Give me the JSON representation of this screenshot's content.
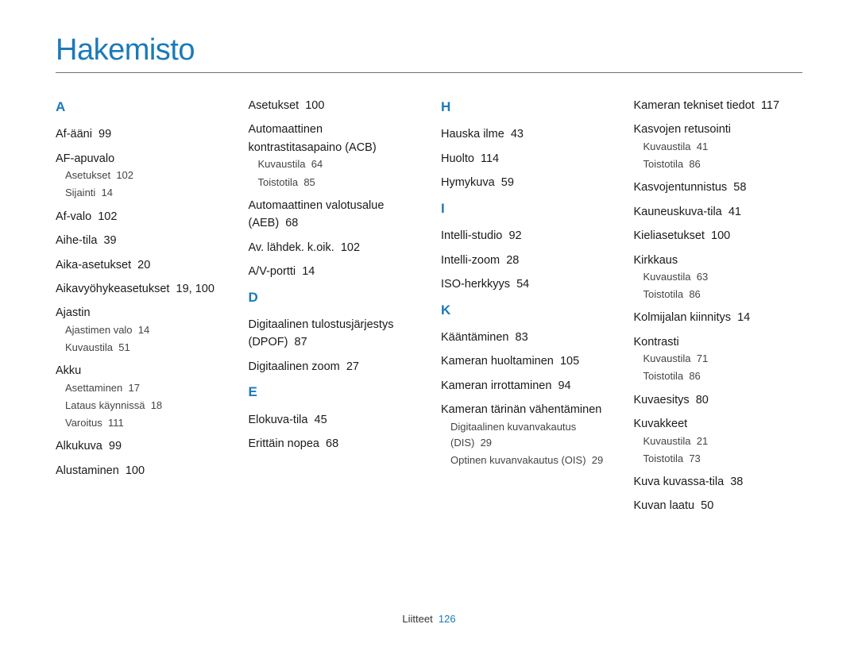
{
  "title": "Hakemisto",
  "footer": {
    "label": "Liitteet",
    "page": "126"
  },
  "columns": [
    [
      {
        "type": "letter",
        "text": "A"
      },
      {
        "type": "entry",
        "text": "Af-ääni",
        "pages": "99"
      },
      {
        "type": "entry",
        "text": "AF-apuvalo",
        "sub": [
          {
            "text": "Asetukset",
            "pages": "102"
          },
          {
            "text": "Sijainti",
            "pages": "14"
          }
        ]
      },
      {
        "type": "entry",
        "text": "Af-valo",
        "pages": "102"
      },
      {
        "type": "entry",
        "text": "Aihe-tila",
        "pages": "39"
      },
      {
        "type": "entry",
        "text": "Aika-asetukset",
        "pages": "20"
      },
      {
        "type": "entry",
        "text": "Aikavyöhykeasetukset",
        "pages": "19, 100"
      },
      {
        "type": "entry",
        "text": "Ajastin",
        "sub": [
          {
            "text": "Ajastimen valo",
            "pages": "14"
          },
          {
            "text": "Kuvaustila",
            "pages": "51"
          }
        ]
      },
      {
        "type": "entry",
        "text": "Akku",
        "sub": [
          {
            "text": "Asettaminen",
            "pages": "17"
          },
          {
            "text": "Lataus käynnissä",
            "pages": "18"
          },
          {
            "text": "Varoitus",
            "pages": "111"
          }
        ]
      },
      {
        "type": "entry",
        "text": "Alkukuva",
        "pages": "99"
      },
      {
        "type": "entry",
        "text": "Alustaminen",
        "pages": "100"
      }
    ],
    [
      {
        "type": "entry",
        "text": "Asetukset",
        "pages": "100"
      },
      {
        "type": "entry",
        "text": "Automaattinen kontrastitasapaino (ACB)",
        "sub": [
          {
            "text": "Kuvaustila",
            "pages": "64"
          },
          {
            "text": "Toistotila",
            "pages": "85"
          }
        ]
      },
      {
        "type": "entry",
        "text": "Automaattinen valotusalue (AEB)",
        "pages": "68"
      },
      {
        "type": "entry",
        "text": "Av. lähdek. k.oik.",
        "pages": "102"
      },
      {
        "type": "entry",
        "text": "A/V-portti",
        "pages": "14"
      },
      {
        "type": "letter",
        "text": "D"
      },
      {
        "type": "entry",
        "text": "Digitaalinen tulostusjärjestys (DPOF)",
        "pages": "87"
      },
      {
        "type": "entry",
        "text": "Digitaalinen zoom",
        "pages": "27"
      },
      {
        "type": "letter",
        "text": "E"
      },
      {
        "type": "entry",
        "text": "Elokuva-tila",
        "pages": "45"
      },
      {
        "type": "entry",
        "text": "Erittäin nopea",
        "pages": "68"
      }
    ],
    [
      {
        "type": "letter",
        "text": "H"
      },
      {
        "type": "entry",
        "text": "Hauska ilme",
        "pages": "43"
      },
      {
        "type": "entry",
        "text": "Huolto",
        "pages": "114"
      },
      {
        "type": "entry",
        "text": "Hymykuva",
        "pages": "59"
      },
      {
        "type": "letter",
        "text": "I"
      },
      {
        "type": "entry",
        "text": "Intelli-studio",
        "pages": "92"
      },
      {
        "type": "entry",
        "text": "Intelli-zoom",
        "pages": "28"
      },
      {
        "type": "entry",
        "text": "ISO-herkkyys",
        "pages": "54"
      },
      {
        "type": "letter",
        "text": "K"
      },
      {
        "type": "entry",
        "text": "Kääntäminen",
        "pages": "83"
      },
      {
        "type": "entry",
        "text": "Kameran huoltaminen",
        "pages": "105"
      },
      {
        "type": "entry",
        "text": "Kameran irrottaminen",
        "pages": "94"
      },
      {
        "type": "entry",
        "text": "Kameran tärinän vähentäminen",
        "sub": [
          {
            "text": "Digitaalinen kuvanvakautus (DIS)",
            "pages": "29"
          },
          {
            "text": "Optinen kuvanvakautus (OIS)",
            "pages": "29"
          }
        ]
      }
    ],
    [
      {
        "type": "entry",
        "text": "Kameran tekniset tiedot",
        "pages": "117"
      },
      {
        "type": "entry",
        "text": "Kasvojen retusointi",
        "sub": [
          {
            "text": "Kuvaustila",
            "pages": "41"
          },
          {
            "text": "Toistotila",
            "pages": "86"
          }
        ]
      },
      {
        "type": "entry",
        "text": "Kasvojentunnistus",
        "pages": "58"
      },
      {
        "type": "entry",
        "text": "Kauneuskuva-tila",
        "pages": "41"
      },
      {
        "type": "entry",
        "text": "Kieliasetukset",
        "pages": "100"
      },
      {
        "type": "entry",
        "text": "Kirkkaus",
        "sub": [
          {
            "text": "Kuvaustila",
            "pages": "63"
          },
          {
            "text": "Toistotila",
            "pages": "86"
          }
        ]
      },
      {
        "type": "entry",
        "text": "Kolmijalan kiinnitys",
        "pages": "14"
      },
      {
        "type": "entry",
        "text": "Kontrasti",
        "sub": [
          {
            "text": "Kuvaustila",
            "pages": "71"
          },
          {
            "text": "Toistotila",
            "pages": "86"
          }
        ]
      },
      {
        "type": "entry",
        "text": "Kuvaesitys",
        "pages": "80"
      },
      {
        "type": "entry",
        "text": "Kuvakkeet",
        "sub": [
          {
            "text": "Kuvaustila",
            "pages": "21"
          },
          {
            "text": "Toistotila",
            "pages": "73"
          }
        ]
      },
      {
        "type": "entry",
        "text": "Kuva kuvassa-tila",
        "pages": "38"
      },
      {
        "type": "entry",
        "text": "Kuvan laatu",
        "pages": "50"
      }
    ]
  ]
}
